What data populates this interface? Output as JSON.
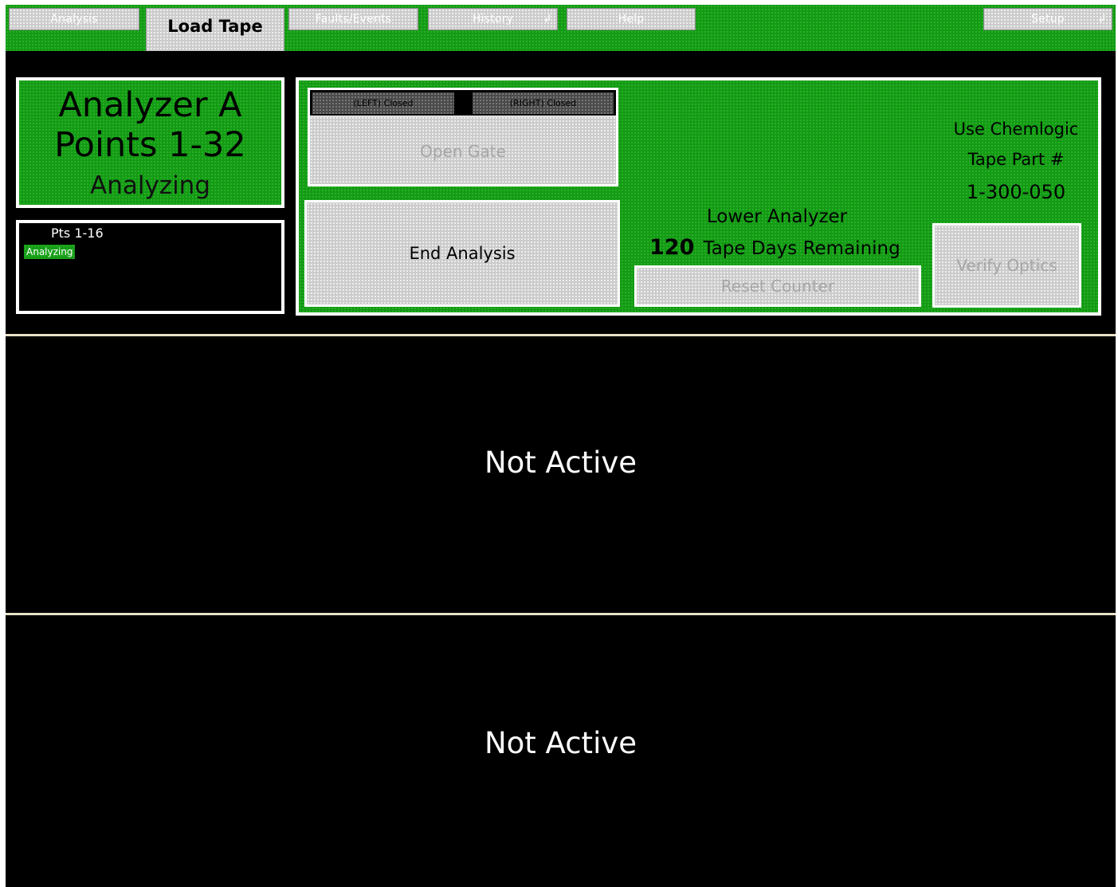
{
  "nav": {
    "tabs": [
      {
        "label": "Analysis"
      },
      {
        "label": "Load Tape",
        "active": true
      },
      {
        "label": "Faults/Events"
      },
      {
        "label": "History",
        "glyph": "↲"
      },
      {
        "label": "Help"
      },
      {
        "label": "Setup",
        "glyph": "↲"
      }
    ]
  },
  "analyzer": {
    "name": "Analyzer A",
    "points": "Points 1-32",
    "status": "Analyzing"
  },
  "points_group": {
    "label": "Pts 1-16",
    "status": "Analyzing"
  },
  "gate": {
    "left_status": "(LEFT) Closed",
    "right_status": "(RIGHT) Closed",
    "open_label": "Open Gate"
  },
  "actions": {
    "end_analysis": "End Analysis",
    "reset_counter": "Reset Counter",
    "verify_optics": "Verify Optics"
  },
  "tape": {
    "lower_analyzer_label": "Lower Analyzer",
    "days_remaining_count": "120",
    "days_remaining_label": "Tape Days Remaining",
    "info_line1": "Use Chemlogic",
    "info_line2": "Tape Part #",
    "part_number": "1-300-050"
  },
  "sections": [
    {
      "status": "Not Active"
    },
    {
      "status": "Not Active"
    }
  ],
  "colors": {
    "panel_green": "#149a14",
    "button_gray": "#cbcbcb",
    "background": "#000000",
    "disabled_text": "#a6a6a6",
    "separator": "#e6e1c6"
  },
  "icons": {
    "dropdown_glyph": "return-arrow-icon"
  }
}
